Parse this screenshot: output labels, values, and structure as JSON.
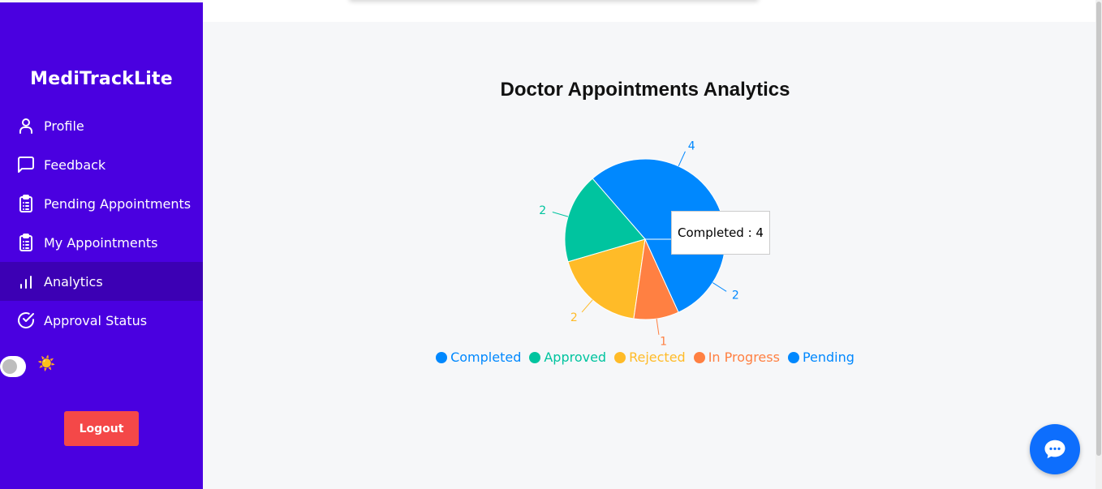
{
  "sidebar": {
    "brand": "MediTrackLite",
    "items": [
      {
        "label": "Profile",
        "icon": "user-icon"
      },
      {
        "label": "Feedback",
        "icon": "message-square-icon"
      },
      {
        "label": "Pending Appointments",
        "icon": "clipboard-list-icon"
      },
      {
        "label": "My Appointments",
        "icon": "clipboard-list-icon"
      },
      {
        "label": "Analytics",
        "icon": "bar-chart-icon",
        "active": true
      },
      {
        "label": "Approval Status",
        "icon": "check-circle-icon"
      }
    ],
    "theme_icon": "☀️",
    "logout_label": "Logout"
  },
  "main": {
    "title": "Doctor Appointments Analytics",
    "tooltip": "Completed : 4"
  },
  "chart_data": {
    "type": "pie",
    "title": "Doctor Appointments Analytics",
    "slices": [
      {
        "label": "Completed",
        "value": 4,
        "color": "#0088fe"
      },
      {
        "label": "Approved",
        "value": 2,
        "color": "#00c49f"
      },
      {
        "label": "Rejected",
        "value": 2,
        "color": "#ffbb28"
      },
      {
        "label": "In Progress",
        "value": 1,
        "color": "#ff8042"
      },
      {
        "label": "Pending",
        "value": 2,
        "color": "#0088fe"
      }
    ],
    "legend_position": "bottom"
  },
  "colors": {
    "sidebar_bg": "#4a00e0",
    "sidebar_active": "#3c00b4",
    "logout": "#f44848",
    "chat_button": "#0d6efd"
  }
}
